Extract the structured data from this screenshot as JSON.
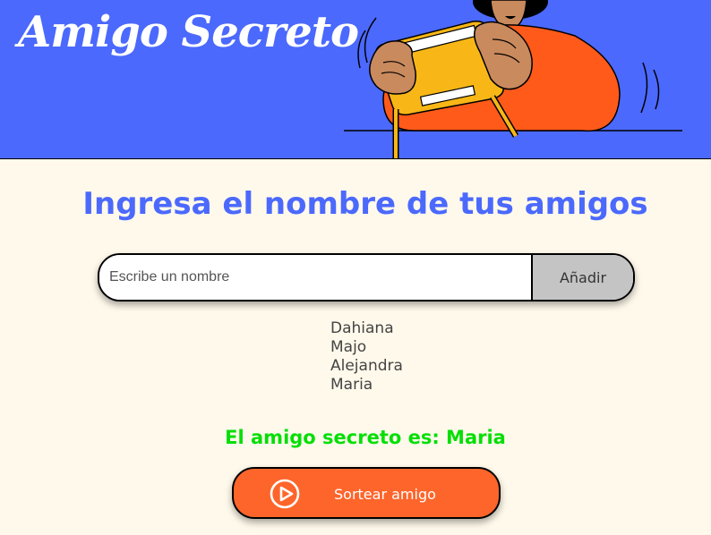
{
  "header": {
    "title": "Amigo Secreto",
    "illustration": "person-playing-handheld-console"
  },
  "main": {
    "section_title": "Ingresa el nombre de tus amigos",
    "input": {
      "placeholder": "Escribe un nombre",
      "value": ""
    },
    "add_button_label": "Añadir",
    "friends": [
      "Dahiana",
      "Majo",
      "Alejandra",
      "Maria"
    ],
    "result_text": "El amigo secreto es: Maria",
    "draw_button_label": "Sortear amigo",
    "draw_button_icon": "play-circle-icon"
  },
  "colors": {
    "header_bg": "#4B69FD",
    "page_bg": "#FFF9EB",
    "title_accent": "#4B69FD",
    "result_green": "#05DF05",
    "draw_button_bg": "#FE652B",
    "add_button_bg": "#C4C4C4"
  }
}
